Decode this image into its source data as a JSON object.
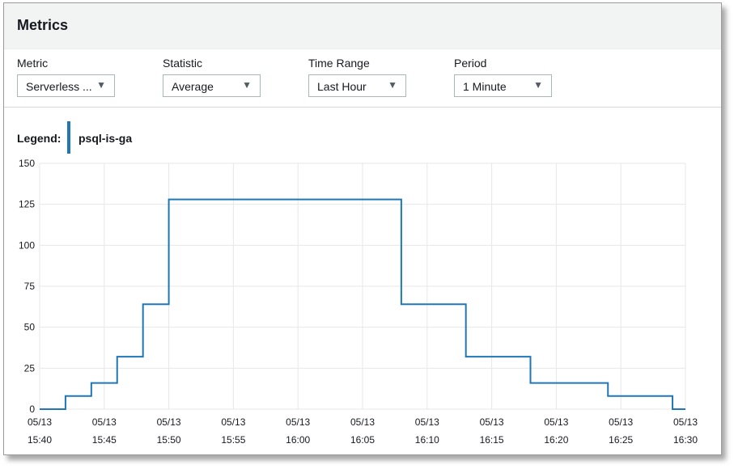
{
  "panel": {
    "title": "Metrics"
  },
  "controls": [
    {
      "label": "Metric",
      "value": "Serverless ..."
    },
    {
      "label": "Statistic",
      "value": "Average"
    },
    {
      "label": "Time Range",
      "value": "Last Hour"
    },
    {
      "label": "Period",
      "value": "1 Minute"
    }
  ],
  "legend": {
    "label": "Legend:",
    "series_name": "psql-is-ga"
  },
  "colors": {
    "series": "#1f77b4",
    "grid": "#e7e7e7",
    "axis_text": "#16191f"
  },
  "icons": {
    "dropdown": "caret-down-icon"
  },
  "chart_data": {
    "type": "line",
    "step": true,
    "series": [
      {
        "name": "psql-is-ga",
        "color": "#1f77b4",
        "points": [
          {
            "x": "15:40",
            "y": 0
          },
          {
            "x": "15:42",
            "y": 8
          },
          {
            "x": "15:44",
            "y": 16
          },
          {
            "x": "15:46",
            "y": 32
          },
          {
            "x": "15:48",
            "y": 64
          },
          {
            "x": "15:50",
            "y": 128
          },
          {
            "x": "16:08",
            "y": 64
          },
          {
            "x": "16:13",
            "y": 32
          },
          {
            "x": "16:18",
            "y": 16
          },
          {
            "x": "16:24",
            "y": 8
          },
          {
            "x": "16:29",
            "y": 0
          },
          {
            "x": "16:30",
            "y": 0
          }
        ]
      }
    ],
    "x_ticks": [
      {
        "date": "05/13",
        "time": "15:40"
      },
      {
        "date": "05/13",
        "time": "15:45"
      },
      {
        "date": "05/13",
        "time": "15:50"
      },
      {
        "date": "05/13",
        "time": "15:55"
      },
      {
        "date": "05/13",
        "time": "16:00"
      },
      {
        "date": "05/13",
        "time": "16:05"
      },
      {
        "date": "05/13",
        "time": "16:10"
      },
      {
        "date": "05/13",
        "time": "16:15"
      },
      {
        "date": "05/13",
        "time": "16:20"
      },
      {
        "date": "05/13",
        "time": "16:25"
      },
      {
        "date": "05/13",
        "time": "16:30"
      }
    ],
    "y_ticks": [
      0,
      25,
      50,
      75,
      100,
      125,
      150
    ],
    "xlim": [
      "15:40",
      "16:30"
    ],
    "ylim": [
      0,
      150
    ],
    "grid": true,
    "legend_position": "top-left"
  }
}
